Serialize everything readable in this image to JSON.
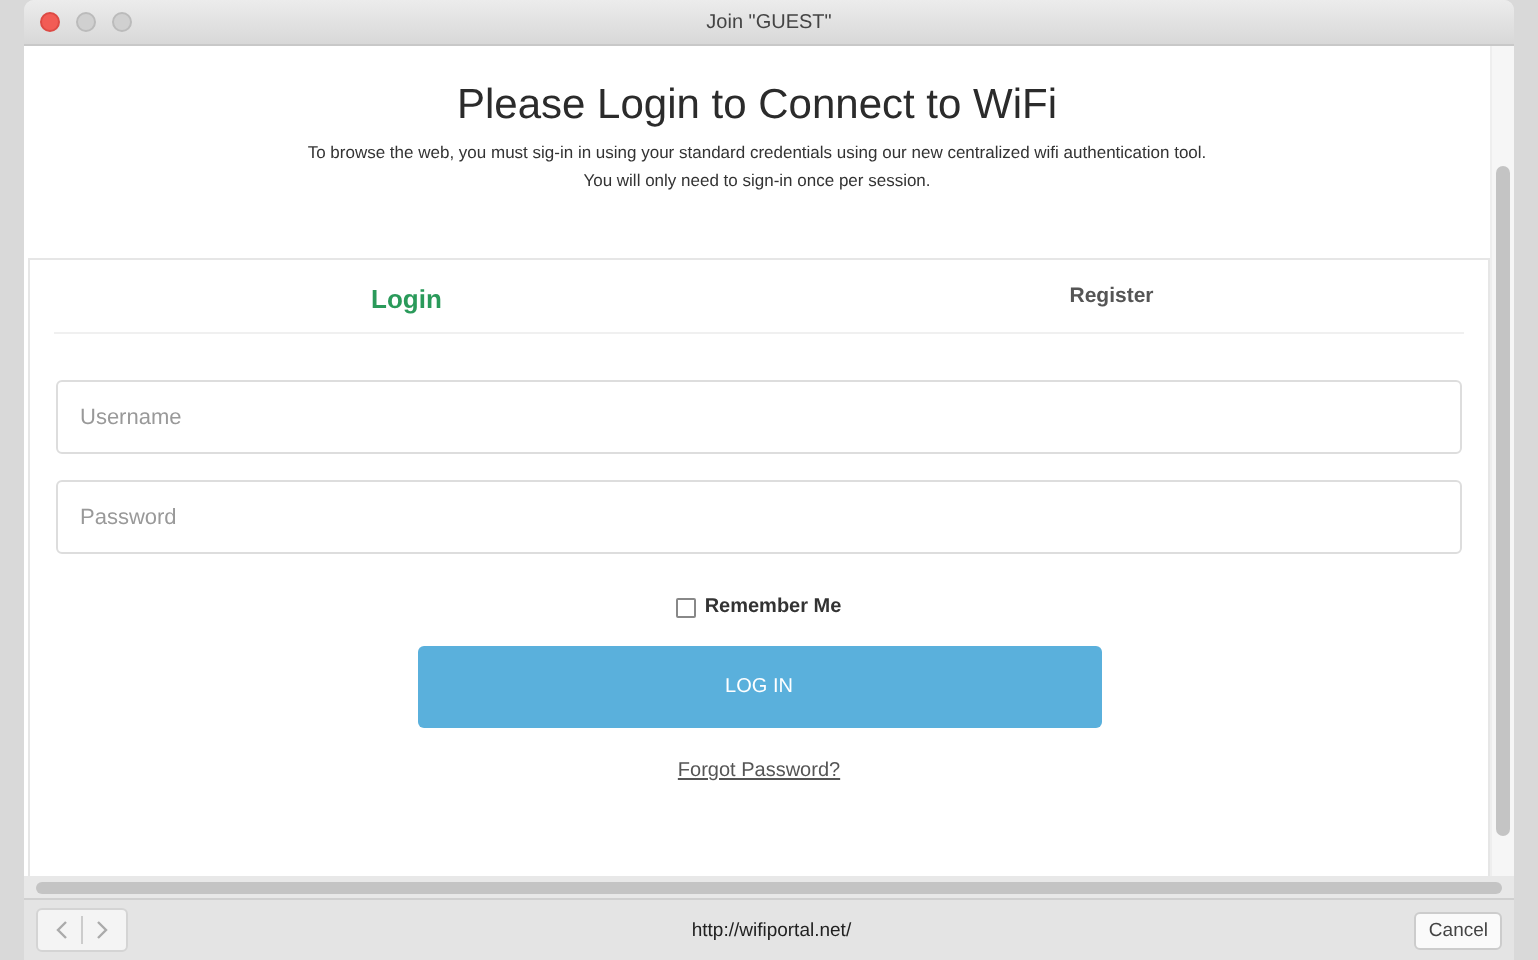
{
  "window": {
    "title": "Join \"GUEST\""
  },
  "heading": "Please Login to Connect to WiFi",
  "description": [
    "To browse the web, you must sig-in in using your standard credentials using our new centralized wifi authentication tool.",
    "You will only need to sign-in once per session."
  ],
  "tabs": [
    {
      "label": "Login",
      "selected": true
    },
    {
      "label": "Register",
      "selected": false
    }
  ],
  "fields": [
    {
      "placeholder": "Username"
    },
    {
      "placeholder": "Password"
    }
  ],
  "remember": {
    "label": "Remember Me",
    "checked": false
  },
  "login_button": "LOG IN",
  "forgot_link": "Forgot Password?",
  "status_bar": {
    "url": "http://wifiportal.net/",
    "cancel": "Cancel"
  }
}
